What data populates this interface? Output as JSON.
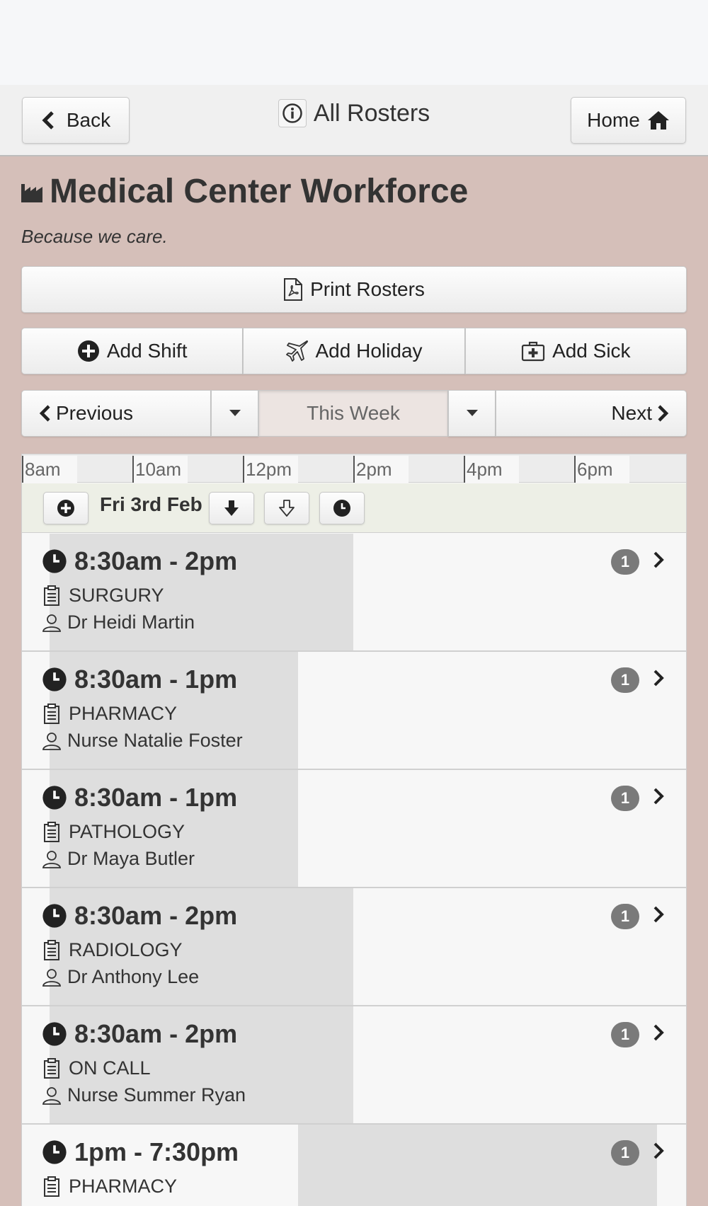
{
  "header": {
    "back_label": "Back",
    "title": "All Rosters",
    "home_label": "Home"
  },
  "page": {
    "title": "Medical Center Workforce",
    "tagline": "Because we care."
  },
  "actions": {
    "print_label": "Print Rosters",
    "add_shift_label": "Add Shift",
    "add_holiday_label": "Add Holiday",
    "add_sick_label": "Add Sick"
  },
  "week_nav": {
    "previous_label": "Previous",
    "current_label": "This Week",
    "next_label": "Next"
  },
  "time_axis": [
    "8am",
    "10am",
    "12pm",
    "2pm",
    "4pm",
    "6pm"
  ],
  "day": {
    "label": "Fri 3rd Feb"
  },
  "shifts": [
    {
      "time": "8:30am - 2pm",
      "department": "SURGURY",
      "person": "Dr Heidi Martin",
      "count": "1"
    },
    {
      "time": "8:30am - 1pm",
      "department": "PHARMACY",
      "person": "Nurse Natalie Foster",
      "count": "1"
    },
    {
      "time": "8:30am - 1pm",
      "department": "PATHOLOGY",
      "person": "Dr Maya Butler",
      "count": "1"
    },
    {
      "time": "8:30am - 2pm",
      "department": "RADIOLOGY",
      "person": "Dr Anthony Lee",
      "count": "1"
    },
    {
      "time": "8:30am - 2pm",
      "department": "ON CALL",
      "person": "Nurse Summer Ryan",
      "count": "1"
    },
    {
      "time": "1pm - 7:30pm",
      "department": "PHARMACY",
      "person": "",
      "count": "1"
    }
  ]
}
